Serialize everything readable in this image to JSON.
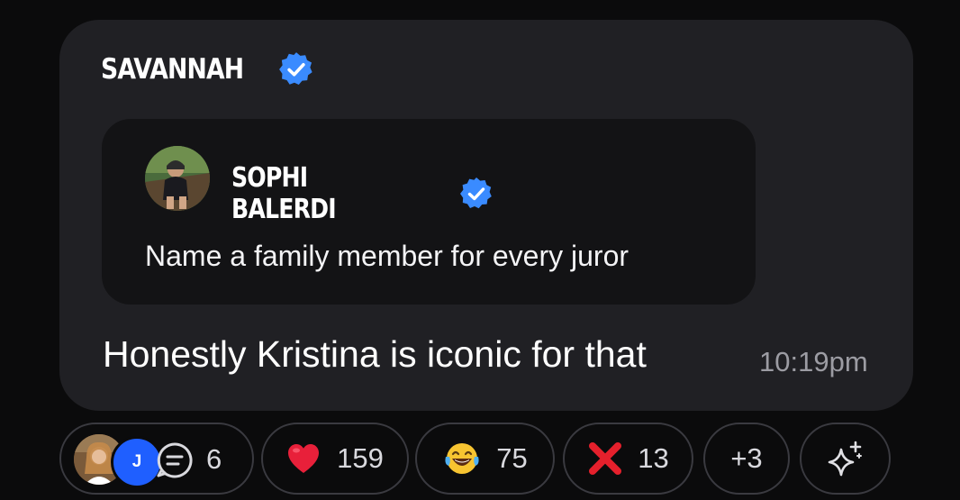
{
  "message": {
    "author": "SAVANNAH",
    "text": "Honestly Kristina is iconic for that",
    "time": "10:19pm"
  },
  "quoted": {
    "author": "SOPHI BALERDI",
    "text": "Name a family member for every juror"
  },
  "reactions": {
    "thread": {
      "avatar_initial": "J",
      "count": "6"
    },
    "heart": {
      "emoji": "heart",
      "count": "159"
    },
    "laugh": {
      "emoji": "tears-of-joy",
      "count": "75"
    },
    "cross": {
      "emoji": "cross-mark",
      "count": "13"
    },
    "more": {
      "label": "+3"
    },
    "add": {
      "icon": "sparkle-icon"
    }
  },
  "colors": {
    "background": "#0b0b0c",
    "bubble": "#202024",
    "quote_card": "#131315",
    "verified": "#3a8bff",
    "avatar_j": "#1f5fff",
    "heart": "#e8203a",
    "cross": "#e5202c"
  }
}
